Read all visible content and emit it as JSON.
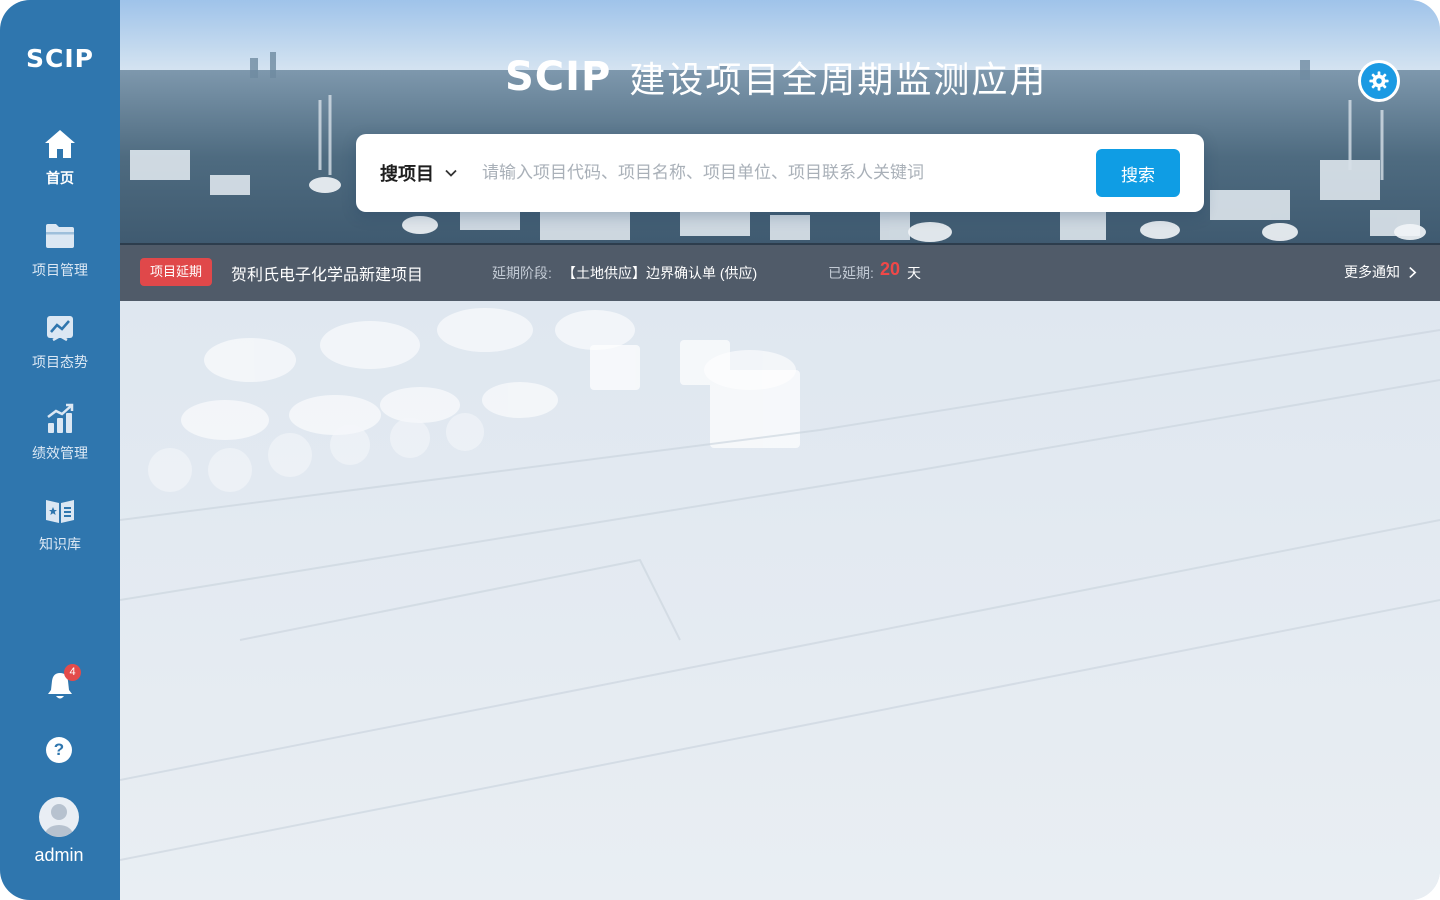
{
  "sidebar": {
    "logo": "SCIP",
    "items": [
      {
        "label": "首页",
        "icon": "home-icon",
        "active": true
      },
      {
        "label": "项目管理",
        "icon": "folder-icon"
      },
      {
        "label": "项目态势",
        "icon": "trend-chart-icon"
      },
      {
        "label": "绩效管理",
        "icon": "bar-chart-icon"
      },
      {
        "label": "知识库",
        "icon": "book-icon"
      }
    ],
    "notifications_count": "4",
    "help_label": "?",
    "username": "admin"
  },
  "header": {
    "logo": "SCIP",
    "title": "建设项目全周期监测应用"
  },
  "search": {
    "type_label": "搜项目",
    "placeholder": "请输入项目代码、项目名称、项目单位、项目联系人关键词",
    "value": "",
    "button_label": "搜索"
  },
  "notice": {
    "tag": "项目延期",
    "project_name": "贺利氏电子化学品新建项目",
    "stage_label": "延期阶段:",
    "stage_value": "【土地供应】边界确认单 (供应)",
    "delay_label": "已延期:",
    "delay_days": "20",
    "delay_unit": "天",
    "more_label": "更多通知"
  },
  "colors": {
    "sidebar_bg": "#2f76ae",
    "accent": "#0f9de4",
    "tag_red": "#e0484a",
    "delay_red": "#f04848"
  }
}
